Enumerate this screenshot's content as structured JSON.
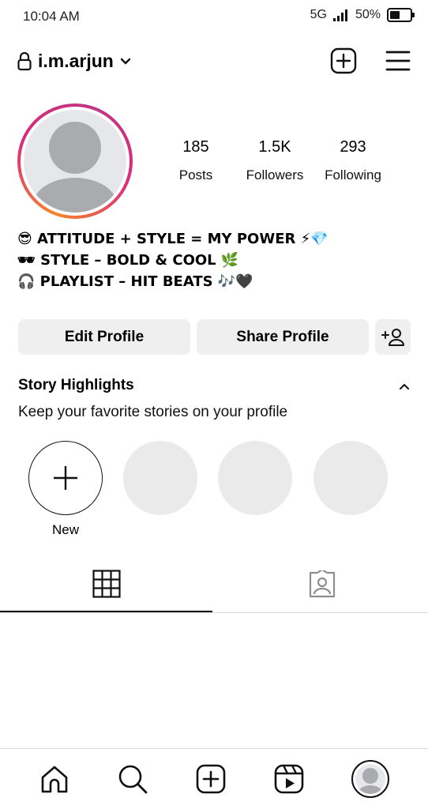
{
  "status_bar": {
    "time": "10:04 AM",
    "network": "5G",
    "battery": "50%"
  },
  "header": {
    "username": "i.m.arjun"
  },
  "stats": {
    "posts": {
      "value": "185",
      "label": "Posts"
    },
    "followers": {
      "value": "1.5K",
      "label": "Followers"
    },
    "following": {
      "value": "293",
      "label": "Following"
    }
  },
  "bio": [
    "😎 ATTITUDE + STYLE = MY POWER ⚡💎",
    "🕶 STYLE – BOLD & COOL 🌿",
    "🎧 PLAYLIST – HIT BEATS 🎶🖤"
  ],
  "buttons": {
    "edit": "Edit Profile",
    "share": "Share Profile"
  },
  "highlights": {
    "title": "Story Highlights",
    "subtitle": "Keep your favorite stories on your profile",
    "new_label": "New"
  },
  "icons": {
    "lock": "lock-icon",
    "chevron": "chevron-down-icon",
    "create": "plus-square-icon",
    "menu": "hamburger-icon",
    "add_user": "add-person-icon",
    "collapse": "chevron-up-icon",
    "grid": "grid-icon",
    "tagged": "tagged-person-icon",
    "home": "home-icon",
    "search": "search-icon",
    "reels": "reels-icon",
    "profile": "profile-avatar"
  }
}
